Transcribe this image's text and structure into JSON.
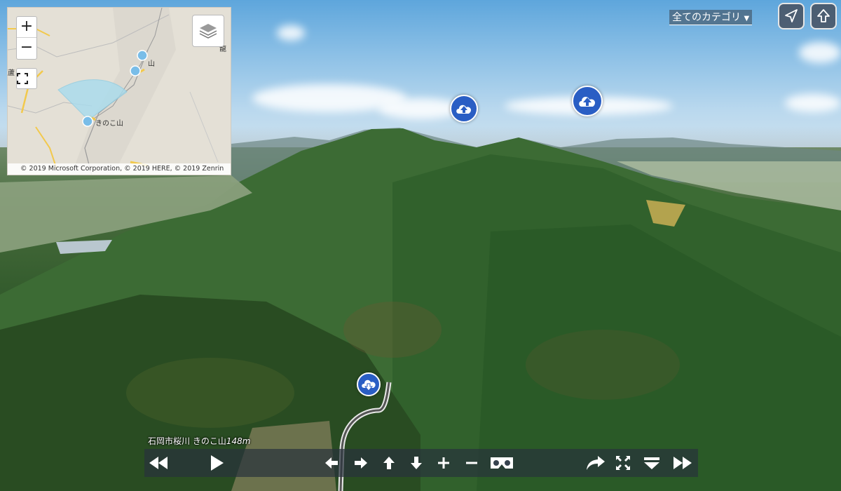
{
  "map": {
    "zoom_in_label": "+",
    "zoom_out_label": "−",
    "attribution": "© 2019 Microsoft Corporation, © 2019 HERE, © 2019 Zenrin",
    "labels": {
      "kinoko": "きのこ山",
      "mountain_2": "山",
      "top_right": "龍",
      "left_edge": "蘆"
    },
    "colors": {
      "fov": "#a8dcee",
      "marker": "#79bde8",
      "road_yellow": "#f2c94c"
    }
  },
  "category": {
    "label": "全てのカテゴリ",
    "arrow": "▼"
  },
  "location": {
    "name": "石岡市桜川 きのこ山",
    "altitude": "148m"
  },
  "hotspots": [
    {
      "type": "cloud-up-icon"
    },
    {
      "type": "cloud-up-icon"
    },
    {
      "type": "cloud-down-icon"
    }
  ],
  "toolbar": {
    "buttons": [
      "rewind-icon",
      "play-icon",
      "arrow-left-icon",
      "arrow-right-icon",
      "arrow-up-icon",
      "arrow-down-icon",
      "zoom-in-icon",
      "zoom-out-icon",
      "vr-icon",
      "share-icon",
      "fullscreen-icon",
      "menu-icon",
      "fast-forward-icon"
    ]
  }
}
